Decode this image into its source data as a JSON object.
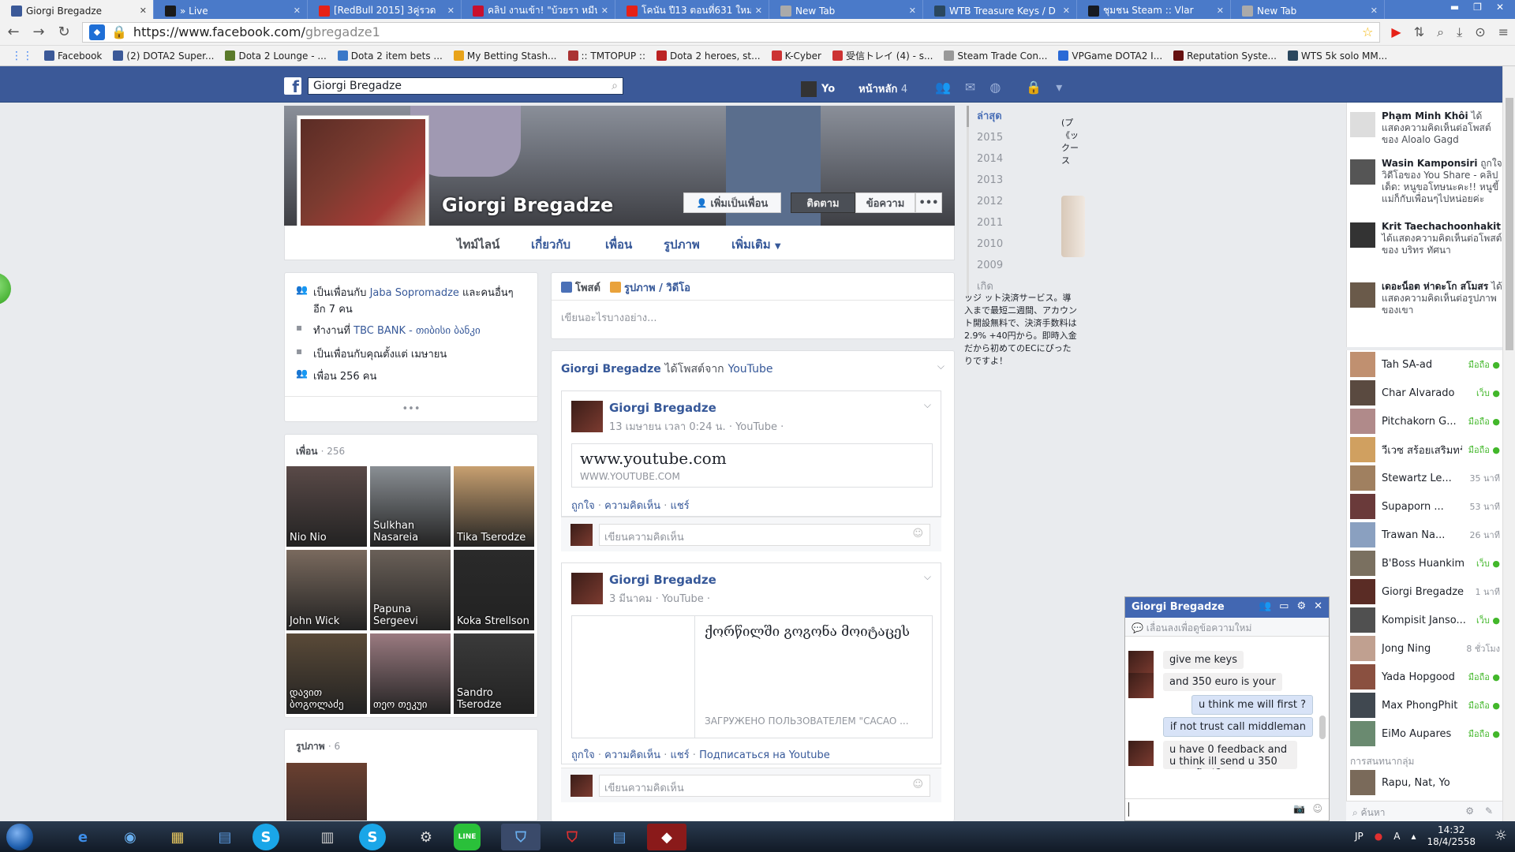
{
  "browser": {
    "tabs": [
      {
        "title": "Giorgi Bregadze",
        "active": true,
        "icon": "facebook-icon",
        "color": "#3b5998"
      },
      {
        "title": "» Live",
        "icon": "live-icon",
        "color": "#1a1a1a"
      },
      {
        "title": "[RedBull 2015] 3คู่รวด",
        "icon": "youtube-icon",
        "color": "#e62117"
      },
      {
        "title": "คลิป งานเข้า! \"บ้วยรา หมีนโจ",
        "icon": "play-icon",
        "color": "#c8102e"
      },
      {
        "title": "โคนัน ปี13 ตอนที่631 ใหม่ล่า",
        "icon": "youtube-icon",
        "color": "#e62117"
      },
      {
        "title": "New Tab",
        "icon": "page-icon",
        "color": "#aaaaaa"
      },
      {
        "title": "WTB Treasure Keys / D",
        "icon": "steam-icon",
        "color": "#2a475e"
      },
      {
        "title": "ชุมชน Steam :: Vlar",
        "icon": "steam-icon",
        "color": "#171a21"
      },
      {
        "title": "New Tab",
        "icon": "page-icon",
        "color": "#aaaaaa"
      }
    ],
    "window_buttons": [
      "▬",
      "❐",
      "✕"
    ],
    "url_host": "https://www.facebook.com/",
    "url_path": "gbregadze1",
    "bookmarks": [
      {
        "label": "Facebook",
        "color": "#3b5998"
      },
      {
        "label": "(2) DOTA2 Super...",
        "color": "#3b5998"
      },
      {
        "label": "Dota 2 Lounge - ...",
        "color": "#5a7a2a"
      },
      {
        "label": "Dota 2 item bets ...",
        "color": "#3a78c8"
      },
      {
        "label": "My Betting Stash...",
        "color": "#e8a31a"
      },
      {
        "label": ":: TMTOPUP ::",
        "color": "#aa3333"
      },
      {
        "label": "Dota 2 heroes, st...",
        "color": "#b22"
      },
      {
        "label": "K-Cyber",
        "color": "#c33"
      },
      {
        "label": "受信トレイ (4) - s...",
        "color": "#c33"
      },
      {
        "label": "Steam Trade Con...",
        "color": "#999"
      },
      {
        "label": "VPGame DOTA2 I...",
        "color": "#2a6ad6"
      },
      {
        "label": "Reputation Syste...",
        "color": "#611"
      },
      {
        "label": "WTS 5k solo MM...",
        "color": "#2a475e"
      }
    ]
  },
  "fb": {
    "search_value": "Giorgi Bregadze",
    "user_name": "Yo",
    "home_label": "หน้าหลัก",
    "home_count": "4"
  },
  "profile": {
    "name": "Giorgi Bregadze",
    "buttons": {
      "add_friend": "เพิ่มเป็นเพื่อน",
      "follow": "ติดตาม",
      "message": "ข้อความ",
      "more": "•••"
    },
    "tabs": [
      "ไทม์ไลน์",
      "เกี่ยวกับ",
      "เพื่อน",
      "รูปภาพ",
      "เพิ่มเติม"
    ],
    "intro": {
      "friends_with_prefix": "เป็นเพื่อนกับ",
      "friends_with_name": "Jaba Sopromadze",
      "friends_with_suffix": "และคนอื่นๆ อีก 7 คน",
      "works_prefix": "ทำงานที่",
      "works_name": "TBC BANK - თიბისი ბანკი",
      "friends_since": "เป็นเพื่อนกับคุณตั้งแต่ เมษายน",
      "friend_count": "เพื่อน 256 คน",
      "more": "•••"
    },
    "friends_title": "เพื่อน",
    "friends_count": "· 256",
    "friends": [
      {
        "name": "Nio Nio",
        "color": "#5a4a48"
      },
      {
        "name": "Sulkhan Nasareia",
        "color": "#8a8f94"
      },
      {
        "name": "Tika Tserodze",
        "color": "#c8a070"
      },
      {
        "name": "John Wick",
        "color": "#7a6a5e"
      },
      {
        "name": "Papuna Sergeevi",
        "color": "#6a6058"
      },
      {
        "name": "Koka Strellson",
        "color": "#2a2a2a"
      },
      {
        "name": "დავით ბოგოლაძე",
        "color": "#5a4a38"
      },
      {
        "name": "თეო თეკუი",
        "color": "#9a7a80"
      },
      {
        "name": "Sandro Tserodze",
        "color": "#3a3a3a"
      }
    ],
    "photos_title": "รูปภาพ",
    "photos_count": "· 6"
  },
  "composer": {
    "tab_post": "โพสต์",
    "tab_photo": "รูปภาพ / วิดีโอ",
    "placeholder": "เขียนอะไรบางอย่าง..."
  },
  "story": {
    "author": "Giorgi Bregadze",
    "middle": "ได้โพสต์จาก",
    "source": "YouTube"
  },
  "posts": [
    {
      "author": "Giorgi Bregadze",
      "date": "13 เมษายน เวลา 0:24 น.",
      "source": "· YouTube ·",
      "link_title": "www.youtube.com",
      "link_domain": "WWW.YOUTUBE.COM",
      "actions": [
        "ถูกใจ",
        "ความคิดเห็น",
        "แชร์"
      ],
      "comment_placeholder": "เขียนความคิดเห็น"
    },
    {
      "author": "Giorgi Bregadze",
      "date": "3 มีนาคม",
      "source": "· YouTube ·",
      "link_title": "ქორწილში გოგონა მოიტაცეს",
      "link_domain": "ЗАГРУЖЕНО ПОЛЬЗОВАТЕЛЕМ \"CACAO ...",
      "actions": [
        "ถูกใจ",
        "ความคิดเห็น",
        "แชร์",
        "Подписаться на Youtube"
      ],
      "comment_placeholder": "เขียนความคิดเห็น"
    }
  ],
  "timeline_years": [
    "ล่าสุด",
    "2015",
    "2014",
    "2013",
    "2012",
    "2011",
    "2010",
    "2009",
    "เกิด"
  ],
  "ad_text_top": "(プ《ックー ス",
  "ad_text_bottom": "ッジ ット決済サービス。導入まで最短二週間、アカウント開設無料で、決済手数料は2.9% +40円から。即時入金だから初めてのECにぴったりですよ！",
  "ticker": [
    {
      "name": "Phạm Minh Khôi",
      "text": "ได้แสดงความคิดเห็นต่อโพสต์ของ Aloalo Gagd",
      "color": "#ddd"
    },
    {
      "name": "Wasin Kamponsiri",
      "text": "ถูกใจวิดีโอของ You Share - คลิปเด็ด: หนูขอโทษนะคะ!! หนูขี้แม่ก็กับเพื่อนๆไปหน่อยค่ะ",
      "color": "#555"
    },
    {
      "name": "Krit Taechachoonhakit",
      "text": "ได้แสดงความคิดเห็นต่อโพสต์ของ บริทร ทัศนา",
      "color": "#333"
    },
    {
      "name": "เดอะน็อต ห่าดะโก สโมสร",
      "text": "ได้แสดงความคิดเห็นต่อรูปภาพของเขา",
      "color": "#6a5a4a"
    }
  ],
  "chat_contacts": [
    {
      "name": "Tah SA-ad",
      "status": "มือถือ",
      "online": true,
      "color": "#c09070"
    },
    {
      "name": "Char Alvarado",
      "status": "เว็บ",
      "online": true,
      "color": "#5a4a40"
    },
    {
      "name": "Pitchakorn G...",
      "status": "มือถือ",
      "online": true,
      "color": "#b08a8a"
    },
    {
      "name": "วีเวซ สร้อยเสริมทรั...",
      "status": "มือถือ",
      "online": true,
      "color": "#d0a060"
    },
    {
      "name": "Stewartz Le...",
      "status": "35 นาที",
      "online": false,
      "color": "#a08060"
    },
    {
      "name": "Supaporn ...",
      "status": "53 นาที",
      "online": false,
      "color": "#6a3a3a"
    },
    {
      "name": "Trawan Na...",
      "status": "26 นาที",
      "online": false,
      "color": "#8aa0c0"
    },
    {
      "name": "B'Boss Huankim",
      "status": "เว็บ",
      "online": true,
      "color": "#7a7060"
    },
    {
      "name": "Giorgi Bregadze",
      "status": "1 นาที",
      "online": false,
      "color": "#5a2c25"
    },
    {
      "name": "Kompisit Janso...",
      "status": "เว็บ",
      "online": true,
      "color": "#505050"
    },
    {
      "name": "Jong Ning",
      "status": "8 ชั่วโมง",
      "online": false,
      "color": "#c0a090"
    },
    {
      "name": "Yada Hopgood",
      "status": "มือถือ",
      "online": true,
      "color": "#8a5040"
    },
    {
      "name": "Max PhongPhit",
      "status": "มือถือ",
      "online": true,
      "color": "#404850"
    },
    {
      "name": "EiMo Aupares",
      "status": "มือถือ",
      "online": true,
      "color": "#6a8a70"
    }
  ],
  "chat_group_label": "การสนทนากลุ่ม",
  "chat_group": "Rapu, Nat, Yo",
  "chat_search": "ค้นหา",
  "chatbox": {
    "title": "Giorgi Bregadze",
    "subheader": "เลื่อนลงเพื่อดูข้อความใหม่",
    "messages": [
      {
        "text": "give me keys",
        "side": "in"
      },
      {
        "text": "and 350 euro is your",
        "side": "in"
      },
      {
        "text": "u think me will first ?",
        "side": "out"
      },
      {
        "text": "if not trust call middleman",
        "side": "out"
      },
      {
        "text": "u have 0 feedback and u think ill send u 350 euro first?",
        "side": "in"
      }
    ]
  },
  "taskbar": {
    "lang": "JP",
    "ime": "A",
    "time": "14:32",
    "date": "18/4/2558"
  }
}
